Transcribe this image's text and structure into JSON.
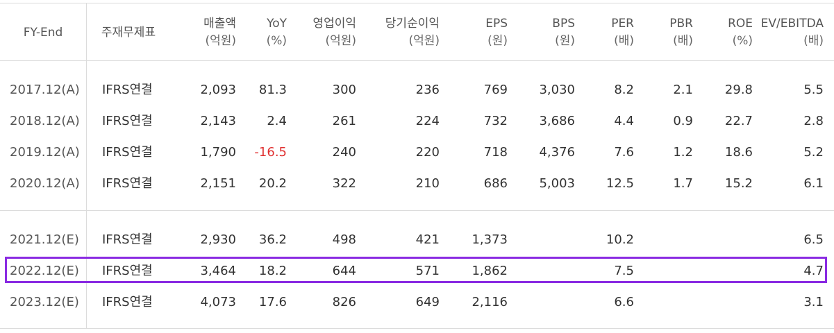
{
  "headers": [
    {
      "label": "FY-End",
      "sub": ""
    },
    {
      "label": "주재무제표",
      "sub": ""
    },
    {
      "label": "매출액",
      "sub": "(억원)"
    },
    {
      "label": "YoY",
      "sub": "(%)"
    },
    {
      "label": "영업이익",
      "sub": "(억원)"
    },
    {
      "label": "당기순이익",
      "sub": "(억원)"
    },
    {
      "label": "EPS",
      "sub": "(원)"
    },
    {
      "label": "BPS",
      "sub": "(원)"
    },
    {
      "label": "PER",
      "sub": "(배)"
    },
    {
      "label": "PBR",
      "sub": "(배)"
    },
    {
      "label": "ROE",
      "sub": "(%)"
    },
    {
      "label": "EV/EBITDA",
      "sub": "(배)"
    }
  ],
  "rows": [
    [
      "2017.12(A)",
      "IFRS연결",
      "2,093",
      "81.3",
      "300",
      "236",
      "769",
      "3,030",
      "8.2",
      "2.1",
      "29.8",
      "5.5"
    ],
    [
      "2018.12(A)",
      "IFRS연결",
      "2,143",
      "2.4",
      "261",
      "224",
      "732",
      "3,686",
      "4.4",
      "0.9",
      "22.7",
      "2.8"
    ],
    [
      "2019.12(A)",
      "IFRS연결",
      "1,790",
      "-16.5",
      "240",
      "220",
      "718",
      "4,376",
      "7.6",
      "1.2",
      "18.6",
      "5.2"
    ],
    [
      "2020.12(A)",
      "IFRS연결",
      "2,151",
      "20.2",
      "322",
      "210",
      "686",
      "5,003",
      "12.5",
      "1.7",
      "15.2",
      "6.1"
    ],
    [
      "2021.12(E)",
      "IFRS연결",
      "2,930",
      "36.2",
      "498",
      "421",
      "1,373",
      "",
      "10.2",
      "",
      "",
      "6.5"
    ],
    [
      "2022.12(E)",
      "IFRS연결",
      "3,464",
      "18.2",
      "644",
      "571",
      "1,862",
      "",
      "7.5",
      "",
      "",
      "4.7"
    ],
    [
      "2023.12(E)",
      "IFRS연결",
      "4,073",
      "17.6",
      "826",
      "649",
      "2,116",
      "",
      "6.6",
      "",
      "",
      "3.1"
    ]
  ],
  "colors": {
    "negative": "#e03030",
    "highlight": "#8a2be2"
  },
  "highlighted_row": "2022.12(E)"
}
